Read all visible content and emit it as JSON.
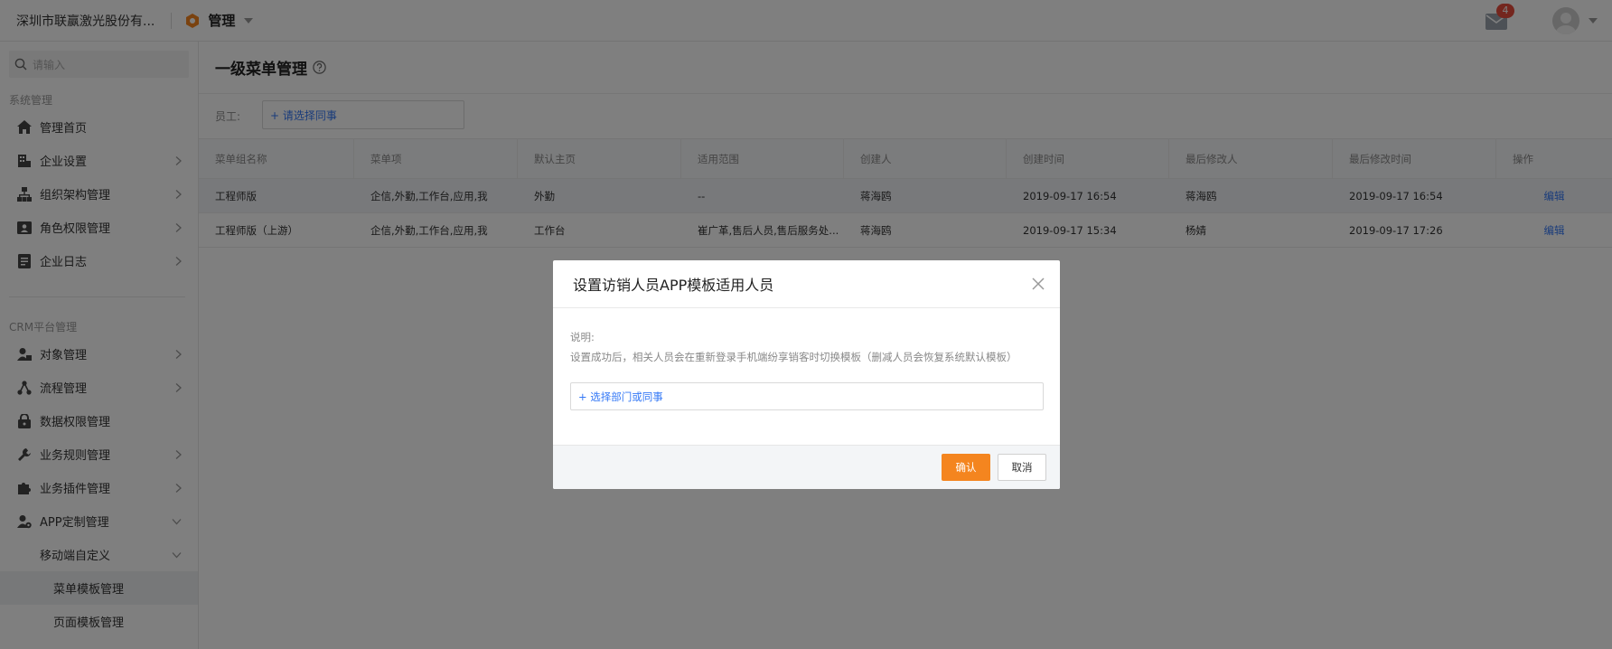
{
  "topbar": {
    "company": "深圳市联赢激光股份有...",
    "app_name": "管理",
    "mail_badge": "4"
  },
  "sidebar": {
    "search_placeholder": "请输入",
    "groups": [
      {
        "title": "系统管理"
      },
      {
        "title": "CRM平台管理"
      }
    ],
    "items": [
      {
        "label": "管理首页",
        "icon": "home-icon"
      },
      {
        "label": "企业设置",
        "icon": "building-icon"
      },
      {
        "label": "组织架构管理",
        "icon": "org-chart-icon"
      },
      {
        "label": "角色权限管理",
        "icon": "id-card-icon"
      },
      {
        "label": "企业日志",
        "icon": "log-icon"
      },
      {
        "label": "对象管理",
        "icon": "object-icon"
      },
      {
        "label": "流程管理",
        "icon": "flow-icon"
      },
      {
        "label": "数据权限管理",
        "icon": "lock-icon"
      },
      {
        "label": "业务规则管理",
        "icon": "wrench-icon"
      },
      {
        "label": "业务插件管理",
        "icon": "puzzle-icon"
      },
      {
        "label": "APP定制管理",
        "icon": "app-custom-icon"
      },
      {
        "label": "移动端自定义"
      },
      {
        "label": "菜单模板管理"
      },
      {
        "label": "页面模板管理"
      }
    ]
  },
  "main": {
    "title": "一级菜单管理",
    "filter_label": "员工:",
    "filter_placeholder": "+ 请选择同事",
    "table": {
      "headers": [
        "菜单组名称",
        "菜单项",
        "默认主页",
        "适用范围",
        "创建人",
        "创建时间",
        "最后修改人",
        "最后修改时间",
        "操作"
      ],
      "rows": [
        [
          "工程师版",
          "企信,外勤,工作台,应用,我",
          "外勤",
          "--",
          "蒋海鸥",
          "2019-09-17 16:54",
          "蒋海鸥",
          "2019-09-17 16:54",
          "编辑"
        ],
        [
          "工程师版（上游）",
          "企信,外勤,工作台,应用,我",
          "工作台",
          "崔广革,售后人员,售后服务处...",
          "蒋海鸥",
          "2019-09-17 15:34",
          "杨婧",
          "2019-09-17 17:26",
          "编辑"
        ]
      ]
    }
  },
  "modal": {
    "title": "设置访销人员APP模板适用人员",
    "desc_label": "说明:",
    "desc_text": "设置成功后，相关人员会在重新登录手机端纷享销客时切换模板（删减人员会恢复系统默认模板）",
    "select_placeholder": "+ 选择部门或同事",
    "confirm_label": "确认",
    "cancel_label": "取消"
  },
  "colors": {
    "accent": "#f4851f",
    "link": "#3478f6",
    "badge": "#e84c3d"
  }
}
